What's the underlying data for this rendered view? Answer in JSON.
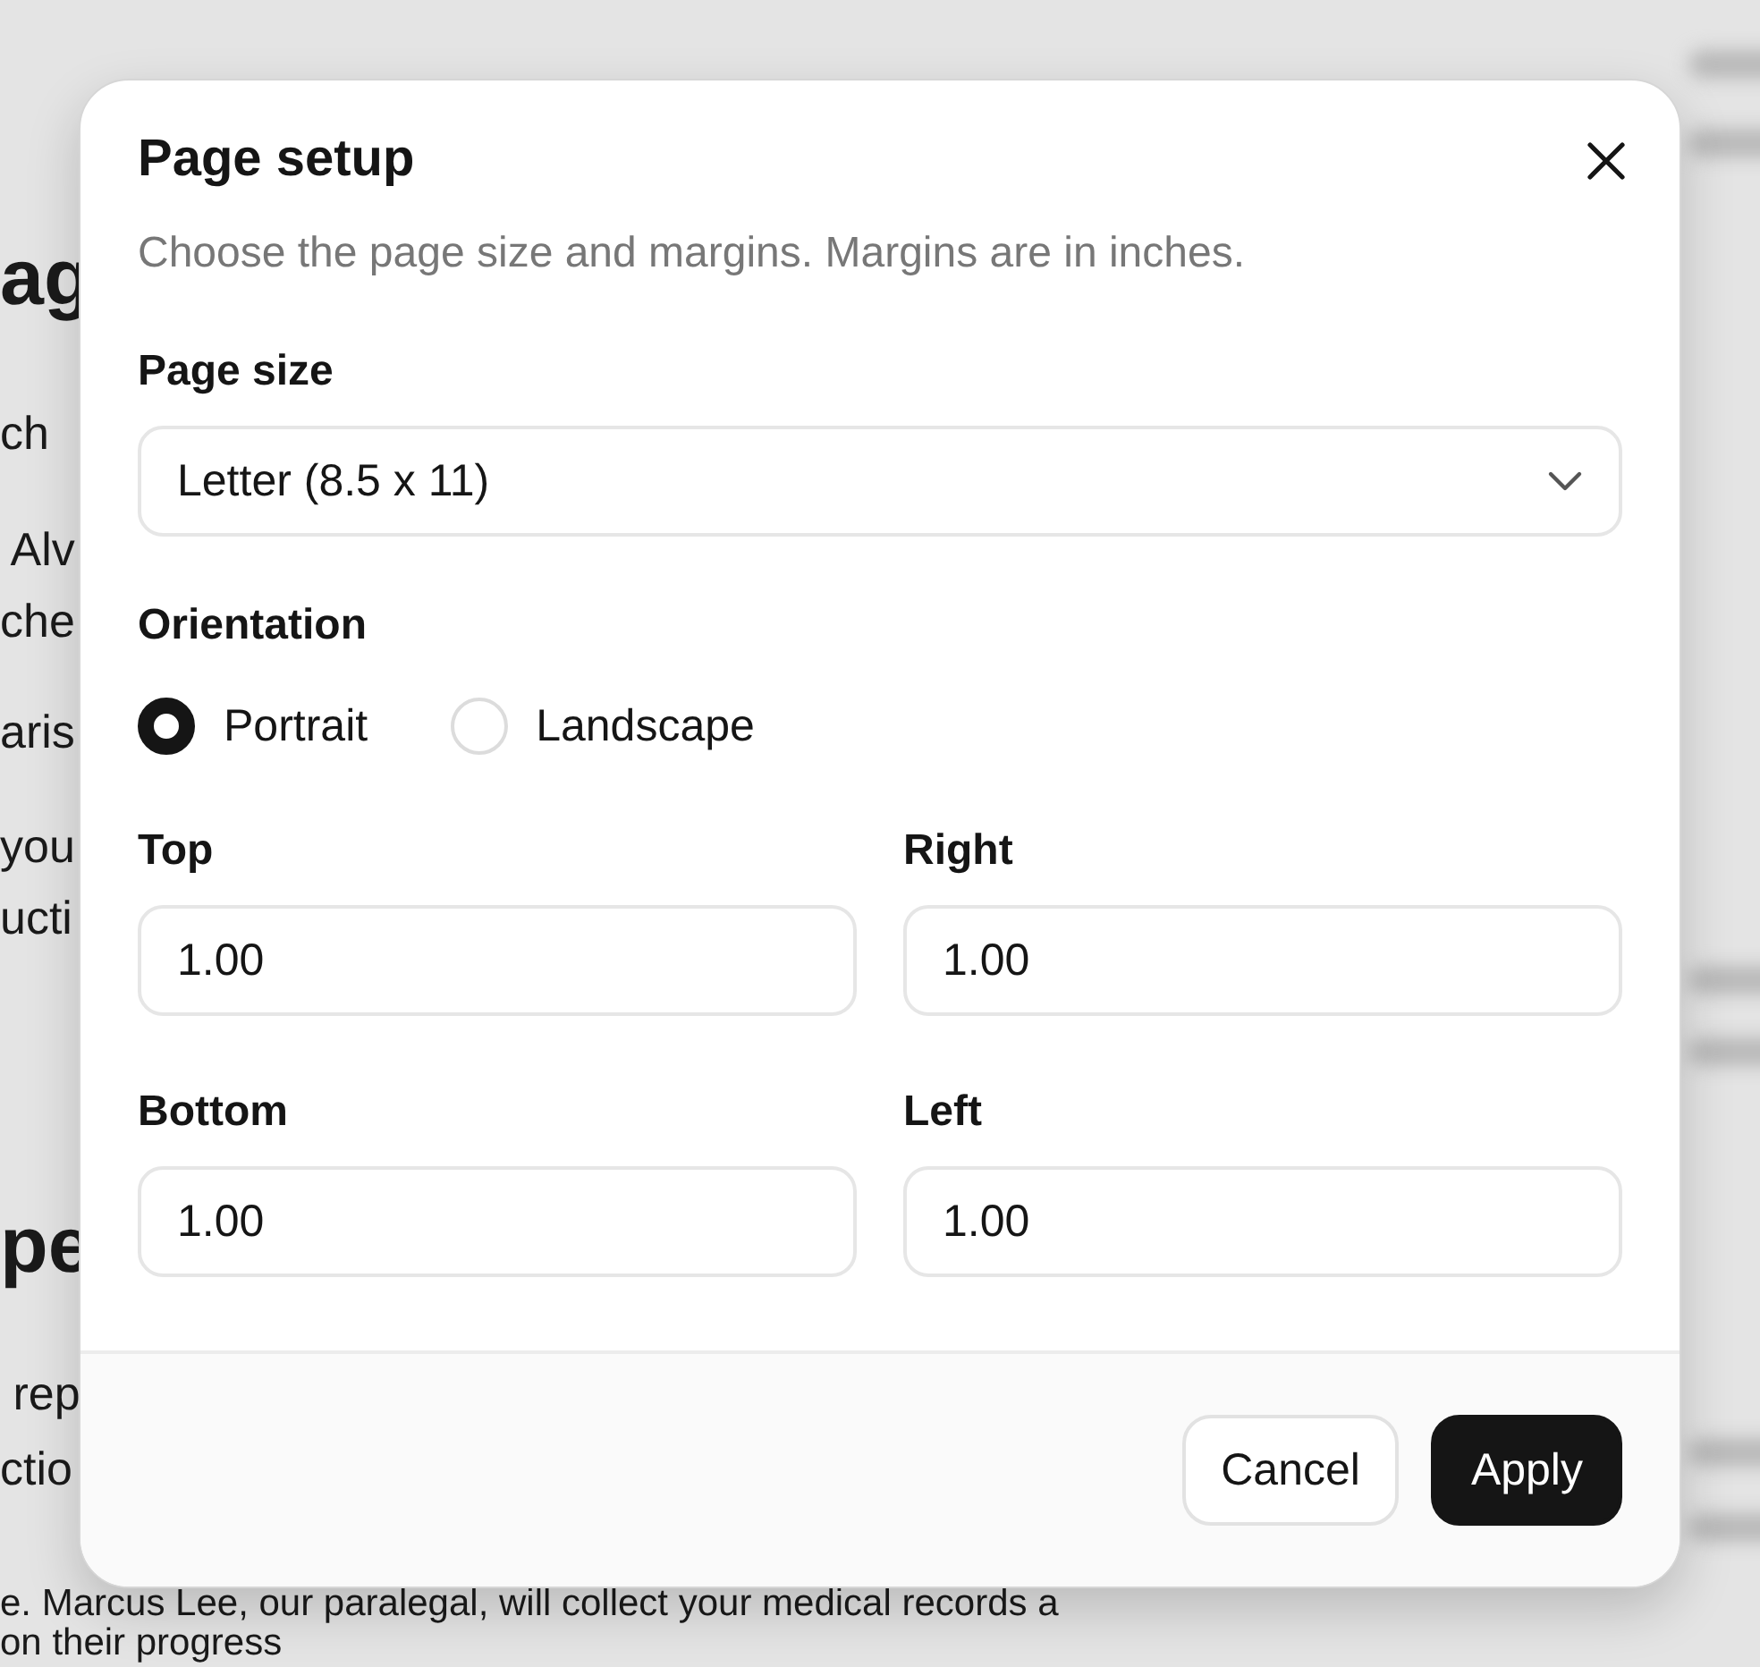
{
  "background": {
    "fragments": [
      {
        "kind": "heading",
        "text": "ag"
      },
      {
        "kind": "text",
        "text": "ch"
      },
      {
        "kind": "text",
        "text": " Alv"
      },
      {
        "kind": "text",
        "text": "che"
      },
      {
        "kind": "text",
        "text": "aris"
      },
      {
        "kind": "text",
        "text": "you"
      },
      {
        "kind": "text",
        "text": "ucti"
      },
      {
        "kind": "heading",
        "text": "pe"
      },
      {
        "kind": "text",
        "text": " rep"
      },
      {
        "kind": "text",
        "text": "ctio"
      }
    ],
    "bottom_lines": [
      "e. Marcus Lee, our paralegal, will collect your medical records a",
      "on their progress"
    ]
  },
  "dialog": {
    "title": "Page setup",
    "description": "Choose the page size and margins. Margins are in inches.",
    "page_size": {
      "label": "Page size",
      "value": "Letter (8.5 x 11)"
    },
    "orientation": {
      "label": "Orientation",
      "options": [
        {
          "label": "Portrait",
          "selected": true
        },
        {
          "label": "Landscape",
          "selected": false
        }
      ]
    },
    "margins": [
      {
        "label": "Top",
        "value": "1.00"
      },
      {
        "label": "Right",
        "value": "1.00"
      },
      {
        "label": "Bottom",
        "value": "1.00"
      },
      {
        "label": "Left",
        "value": "1.00"
      }
    ],
    "buttons": [
      {
        "label": "Cancel",
        "kind": "secondary"
      },
      {
        "label": "Apply",
        "kind": "primary"
      }
    ]
  }
}
